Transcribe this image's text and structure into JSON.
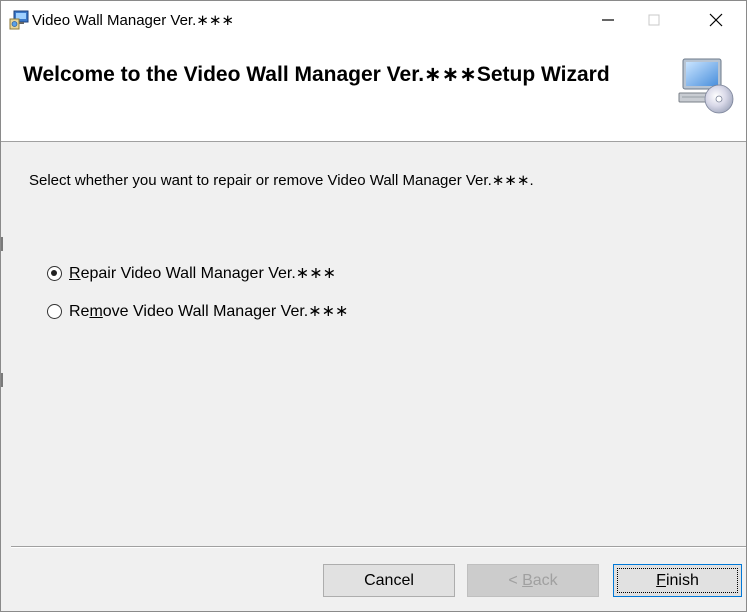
{
  "window": {
    "title": "Video Wall Manager Ver.∗∗∗",
    "controls": {
      "minimize": "─",
      "maximize": "☐",
      "close": "✕"
    }
  },
  "banner": {
    "title": "Welcome to the Video Wall Manager Ver.∗∗∗Setup Wizard",
    "icon": "computer-cd-icon"
  },
  "body": {
    "description": "Select whether you want to repair or remove Video Wall Manager Ver.∗∗∗.",
    "options": [
      {
        "accel": "R",
        "rest": "epair Video Wall Manager Ver.∗∗∗",
        "selected": true
      },
      {
        "pre": "Re",
        "accel": "m",
        "rest": "ove Video Wall Manager Ver.∗∗∗",
        "selected": false
      }
    ]
  },
  "buttons": {
    "cancel": "Cancel",
    "back": {
      "pre": "< ",
      "accel": "B",
      "rest": "ack",
      "enabled": false
    },
    "finish": {
      "accel": "F",
      "rest": "inish"
    }
  },
  "colors": {
    "accent": "#0078d7",
    "dialog_bg": "#f0f0f0",
    "disabled_text": "#a0a0a0"
  }
}
